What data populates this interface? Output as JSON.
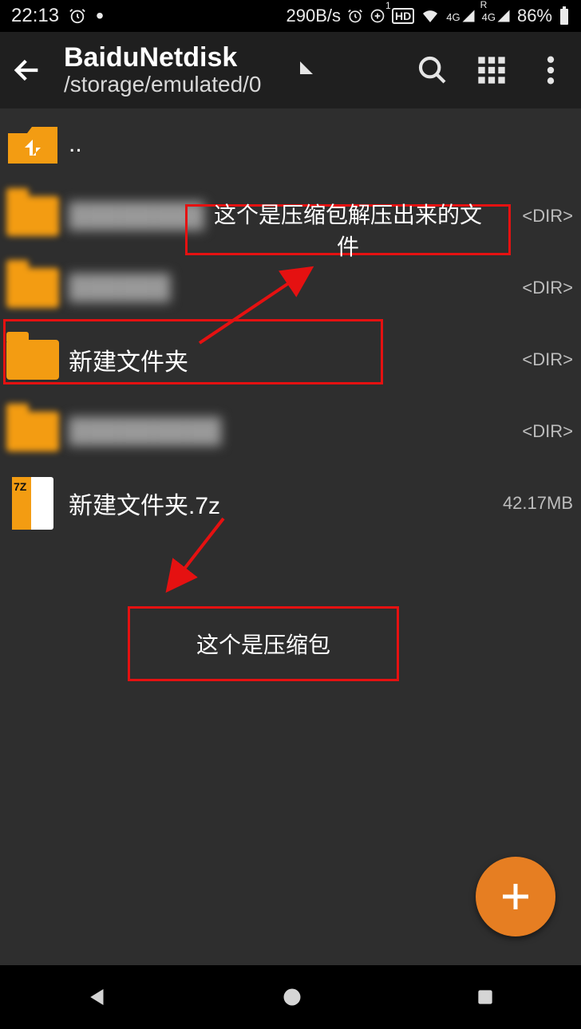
{
  "status": {
    "time": "22:13",
    "net_speed": "290B/s",
    "hd_label": "HD",
    "net_gen_1": "4G",
    "net_gen_2": "4G",
    "roaming": "R",
    "battery": "86%"
  },
  "toolbar": {
    "title": "BaiduNetdisk",
    "subtitle": "/storage/emulated/0"
  },
  "list": {
    "up": "..",
    "dir_tag": "<DIR>",
    "items": [
      {
        "name": "",
        "meta": "<DIR>",
        "blurred": true
      },
      {
        "name": "",
        "meta": "<DIR>",
        "blurred": true
      },
      {
        "name": "新建文件夹",
        "meta": "<DIR>",
        "blurred": false
      },
      {
        "name": "",
        "meta": "<DIR>",
        "blurred": true
      },
      {
        "name": "新建文件夹.7z",
        "meta": "42.17MB",
        "file": true
      }
    ]
  },
  "annotations": {
    "top_label": "这个是压缩包解压出来的文件",
    "bottom_label": "这个是压缩包"
  }
}
